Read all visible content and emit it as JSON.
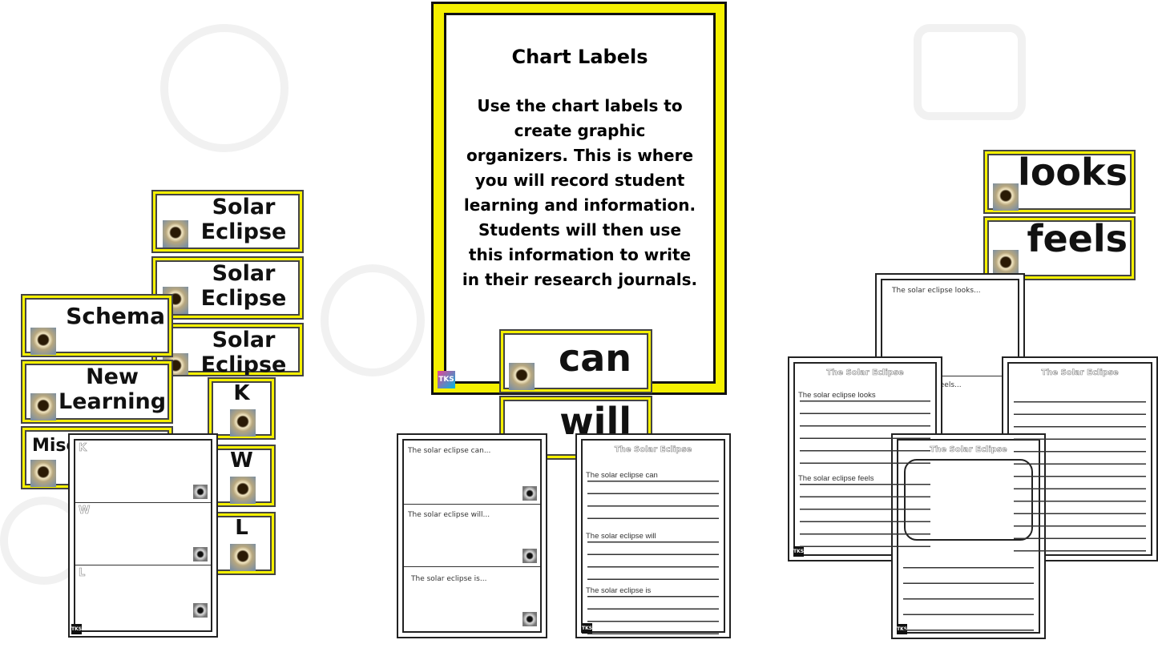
{
  "poster": {
    "title": "Chart Labels",
    "body": "Use the chart labels to create graphic organizers. This is where you will record student learning and information. Students will then use this information to write in their research journals.",
    "logo": "TKS"
  },
  "labels": {
    "solar1": "Solar Eclipse",
    "solar2": "Solar Eclipse",
    "solar3": "Solar Eclipse",
    "schema": "Schema",
    "new_learning": "New Learning",
    "misc": "Misc",
    "k": "K",
    "w": "W",
    "l": "L",
    "can": "can",
    "will": "will",
    "looks": "looks",
    "feels": "feels"
  },
  "kwl_sheet": {
    "sections": [
      "K",
      "W",
      "L"
    ],
    "logo": "TKS"
  },
  "can_will_sheet": {
    "prompts": [
      "The solar eclipse can...",
      "The solar eclipse will...",
      "The solar eclipse is..."
    ]
  },
  "can_will_journal": {
    "title": "The Solar Eclipse",
    "prompts": [
      "The solar eclipse can",
      "The solar eclipse will",
      "The solar eclipse is"
    ],
    "logo": "TKS"
  },
  "looks_sheet": {
    "prompts": [
      "The solar eclipse looks...",
      "...feels..."
    ]
  },
  "looks_journal": {
    "title": "The Solar Eclipse",
    "prompts": [
      "The solar eclipse looks",
      "The solar eclipse feels"
    ],
    "logo": "TKS"
  },
  "lined_journal": {
    "title": "The Solar Eclipse"
  },
  "draw_journal": {
    "title": "The Solar Eclipse",
    "logo": "TKS"
  },
  "colors": {
    "accent": "#f5f000",
    "border": "#222222"
  }
}
